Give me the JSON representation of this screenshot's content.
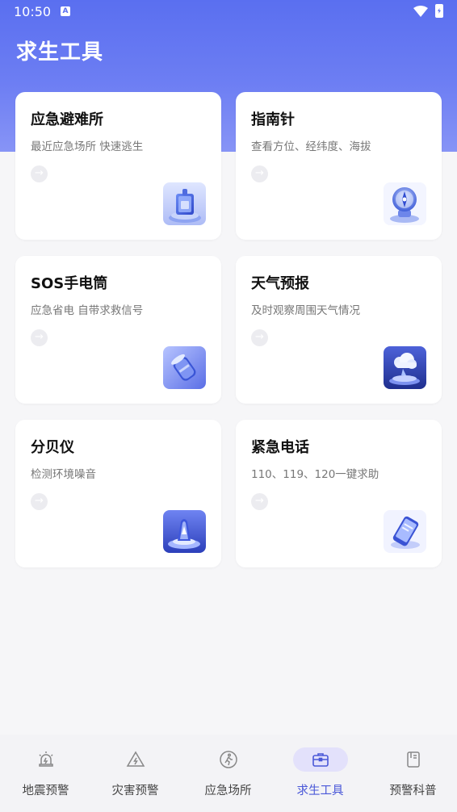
{
  "status_bar": {
    "time": "10:50",
    "notification": "A"
  },
  "header": {
    "title": "求生工具"
  },
  "tools": [
    {
      "title": "应急避难所",
      "description": "最近应急场所 快速逃生",
      "icon": "shelter-3d-icon"
    },
    {
      "title": "指南针",
      "description": "查看方位、经纬度、海拔",
      "icon": "compass-3d-icon"
    },
    {
      "title": "SOS手电筒",
      "description": "应急省电 自带求救信号",
      "icon": "flashlight-3d-icon"
    },
    {
      "title": "天气预报",
      "description": "及时观察周围天气情况",
      "icon": "weather-3d-icon"
    },
    {
      "title": "分贝仪",
      "description": "检测环境噪音",
      "icon": "decibel-meter-3d-icon"
    },
    {
      "title": "紧急电话",
      "description": "110、119、120一键求助",
      "icon": "phone-3d-icon"
    }
  ],
  "arrow_glyph": "→",
  "bottom_nav": [
    {
      "label": "地震预警",
      "icon": "alarm-light-icon",
      "active": false
    },
    {
      "label": "灾害预警",
      "icon": "warning-triangle-icon",
      "active": false
    },
    {
      "label": "应急场所",
      "icon": "person-walking-icon",
      "active": false
    },
    {
      "label": "求生工具",
      "icon": "toolbox-icon",
      "active": true
    },
    {
      "label": "预警科普",
      "icon": "book-icon",
      "active": false
    }
  ],
  "colors": {
    "accent": "#4a58d8",
    "header_gradient_top": "#5a6ff0",
    "header_gradient_bottom": "#8794f6"
  }
}
